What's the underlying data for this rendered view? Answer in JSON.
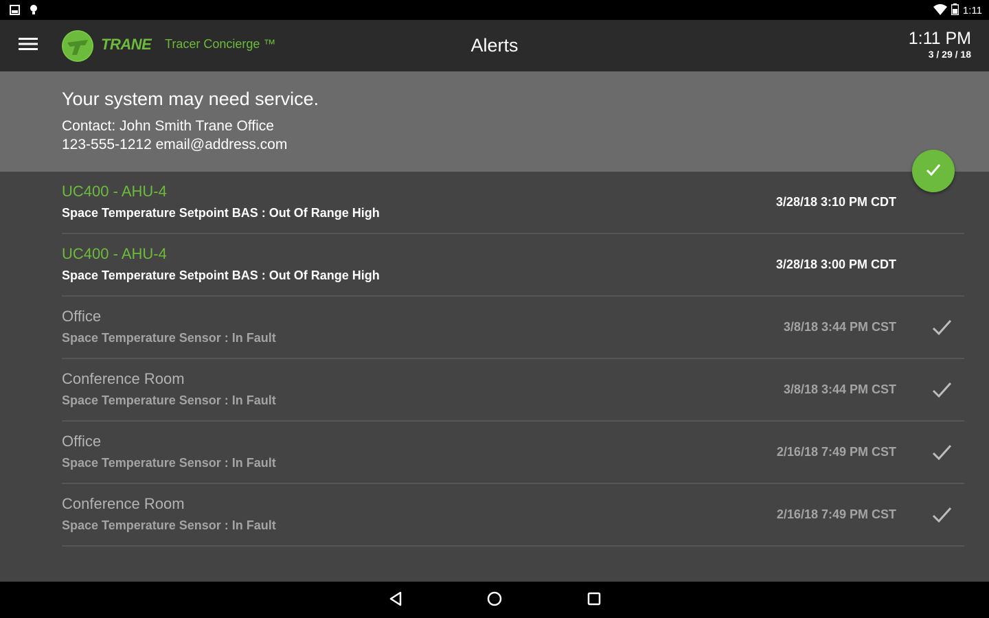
{
  "status_bar": {
    "time": "1:11",
    "icons": [
      "gallery-icon",
      "notification-icon",
      "wifi-icon",
      "battery-icon"
    ]
  },
  "app_bar": {
    "brand": "TRANE",
    "product": "Tracer Concierge ™",
    "title": "Alerts",
    "time": "1:11 PM",
    "date": "3 / 29 / 18"
  },
  "banner": {
    "headline": "Your system may need service.",
    "contact_line1": "Contact: John Smith Trane Office",
    "contact_line2": "123-555-1212 email@address.com"
  },
  "alerts": [
    {
      "name": "UC400 - AHU-4",
      "description": "Space Temperature Setpoint BAS : Out Of Range High",
      "timestamp": "3/28/18 3:10 PM CDT",
      "acknowledged": false
    },
    {
      "name": "UC400 - AHU-4",
      "description": "Space Temperature Setpoint BAS : Out Of Range High",
      "timestamp": "3/28/18 3:00 PM CDT",
      "acknowledged": false
    },
    {
      "name": "Office",
      "description": "Space Temperature Sensor : In Fault",
      "timestamp": "3/8/18 3:44 PM CST",
      "acknowledged": true
    },
    {
      "name": "Conference Room",
      "description": "Space Temperature Sensor : In Fault",
      "timestamp": "3/8/18 3:44 PM CST",
      "acknowledged": true
    },
    {
      "name": "Office",
      "description": "Space Temperature Sensor : In Fault",
      "timestamp": "2/16/18 7:49 PM CST",
      "acknowledged": true
    },
    {
      "name": "Conference Room",
      "description": "Space Temperature Sensor : In Fault",
      "timestamp": "2/16/18 7:49 PM CST",
      "acknowledged": true
    }
  ],
  "colors": {
    "accent_green": "#6cbb3c",
    "app_bar_bg": "#2b2b2b",
    "banner_bg": "#6b6b6b",
    "list_bg": "#444444"
  }
}
